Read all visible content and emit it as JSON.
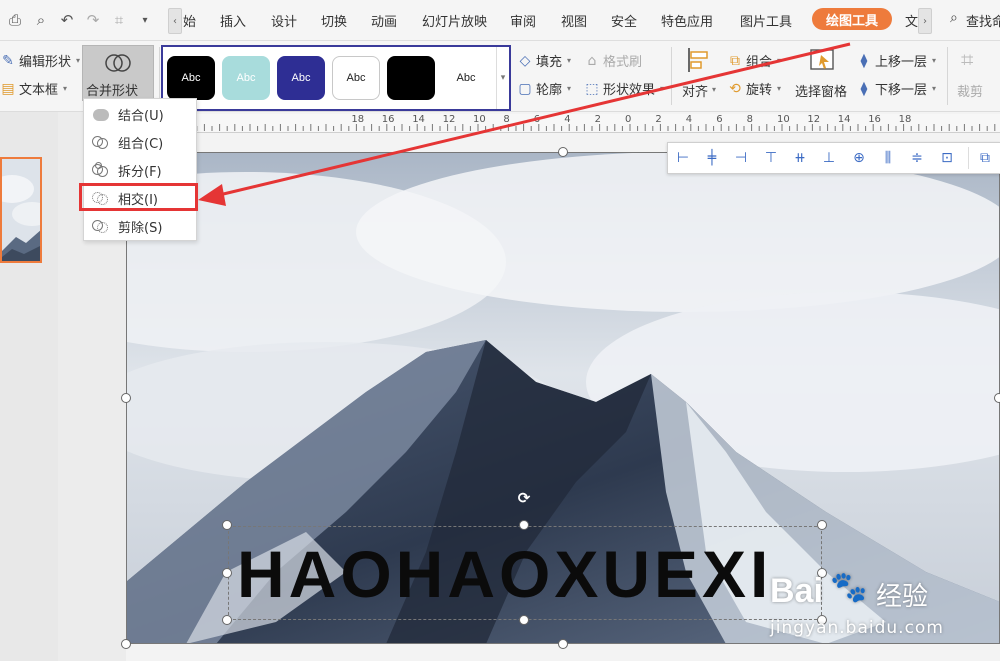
{
  "menu": {
    "tabs": [
      "始",
      "插入",
      "设计",
      "切换",
      "动画",
      "幻灯片放映",
      "审阅",
      "视图",
      "安全",
      "特色应用",
      "图片工具"
    ],
    "active_tab": "绘图工具",
    "overflow_tab": "文",
    "search_label": "查找命"
  },
  "ribbon": {
    "edit_shape": "编辑形状",
    "text_box": "文本框",
    "merge_shape": "合并形状",
    "styles": [
      {
        "label": "Abc",
        "bg": "#ffffff",
        "fg": "#222222",
        "border": "#3a3a9a"
      },
      {
        "label": "Abc",
        "bg": "#000000",
        "fg": "#ffffff",
        "border": "#000000"
      },
      {
        "label": "Abc",
        "bg": "#a8dcdc",
        "fg": "#ffffff",
        "border": "#a8dcdc"
      },
      {
        "label": "Abc",
        "bg": "#2e2e94",
        "fg": "#ffffff",
        "border": "#2e2e94"
      },
      {
        "label": "",
        "bg": "#ffffff",
        "fg": "#222222",
        "border": "#c8c8c8"
      },
      {
        "label": "Abc",
        "bg": "#000000",
        "fg": "#ffffff",
        "border": "#000000"
      }
    ],
    "fill": "填充",
    "format_painter": "格式刷",
    "outline": "轮廓",
    "shape_effects": "形状效果",
    "align": "对齐",
    "group": "组合",
    "rotate": "旋转",
    "selection_pane": "选择窗格",
    "bring_forward": "上移一层",
    "send_backward": "下移一层",
    "crop": "裁剪"
  },
  "merge_menu": {
    "items": [
      "结合(U)",
      "组合(C)",
      "拆分(F)",
      "相交(I)",
      "剪除(S)"
    ],
    "highlighted": "相交(I)"
  },
  "ruler": {
    "labels": [
      "18",
      "16",
      "14",
      "12",
      "10",
      "8",
      "6",
      "4",
      "2",
      "0",
      "2",
      "4",
      "6",
      "8",
      "10",
      "12",
      "14",
      "16",
      "18"
    ]
  },
  "slide": {
    "wordart_text": "HAOHAOXUEXI"
  },
  "watermark": {
    "brand": "Bai",
    "brand_cn": "经验",
    "url": "jingyan.baidu.com"
  },
  "colors": {
    "accent": "#ee7b3c",
    "highlight_red": "#e53535"
  }
}
